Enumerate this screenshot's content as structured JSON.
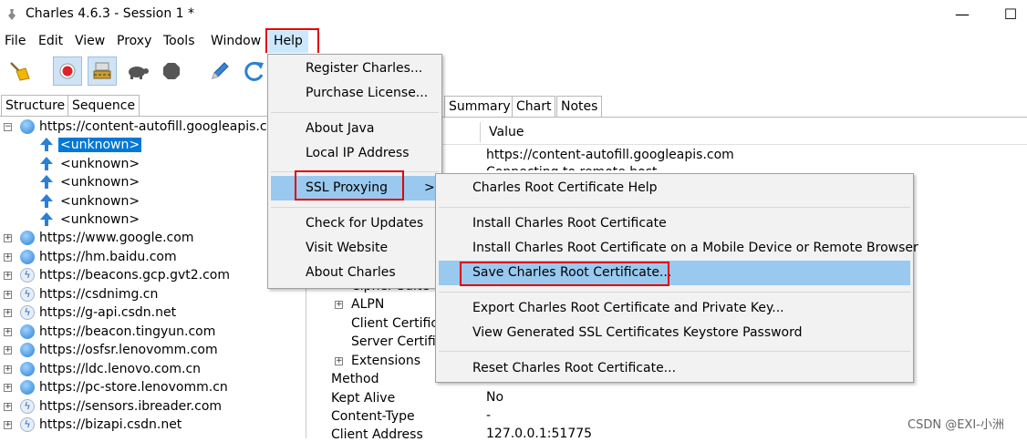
{
  "window": {
    "title": "Charles 4.6.3 - Session 1 *",
    "minimize_glyph": "—",
    "maximize_glyph": "☐"
  },
  "menubar": [
    "File",
    "Edit",
    "View",
    "Proxy",
    "Tools",
    "Window",
    "Help"
  ],
  "left_tabs": [
    "Structure",
    "Sequence"
  ],
  "tree": {
    "root": "https://content-autofill.googleapis.com",
    "children": [
      "<unknown>",
      "<unknown>",
      "<unknown>",
      "<unknown>",
      "<unknown>"
    ],
    "hosts": [
      "https://www.google.com",
      "https://hm.baidu.com",
      "https://beacons.gcp.gvt2.com",
      "https://csdnimg.cn",
      "https://g-api.csdn.net",
      "https://beacon.tingyun.com",
      "https://osfsr.lenovomm.com",
      "https://ldc.lenovo.com.cn",
      "https://pc-store.lenovomm.cn",
      "https://sensors.ibreader.com",
      "https://bizapi.csdn.net"
    ]
  },
  "right_tabs": [
    "Summary",
    "Chart",
    "Notes"
  ],
  "detail": {
    "value_header": "Value",
    "url_value": "https://content-autofill.googleapis.com",
    "partial_value": "Connecting to remote host",
    "cipher_suite": "Cipher Suite",
    "alpn": "ALPN",
    "client_cert": "Client Certifica",
    "server_cert": "Server Certific",
    "extensions": "Extensions",
    "method": "Method",
    "kept_alive": "Kept Alive",
    "kept_alive_value": "No",
    "content_type": "Content-Type",
    "content_type_value": "-",
    "client_address": "Client Address",
    "client_address_value": "127.0.0.1:51775"
  },
  "help_menu": {
    "register": "Register Charles...",
    "purchase": "Purchase License...",
    "about_java": "About Java",
    "local_ip": "Local IP Address",
    "ssl_proxying": "SSL Proxying",
    "check_updates": "Check for Updates",
    "visit_website": "Visit Website",
    "about_charles": "About Charles",
    "submenu_arrow": ">"
  },
  "ssl_submenu": {
    "root_help": "Charles Root Certificate Help",
    "install_root": "Install Charles Root Certificate",
    "install_mobile": "Install Charles Root Certificate on a Mobile Device or Remote Browser",
    "save_root": "Save Charles Root Certificate...",
    "export_root": "Export Charles Root Certificate and Private Key...",
    "view_keystore": "View Generated SSL Certificates Keystore Password",
    "reset_root": "Reset Charles Root Certificate..."
  },
  "watermark": "CSDN @EXI-小洲",
  "colors": {
    "selection": "#0078d7",
    "menu_highlight": "#99c9ef",
    "annotation_red": "#e00000"
  }
}
